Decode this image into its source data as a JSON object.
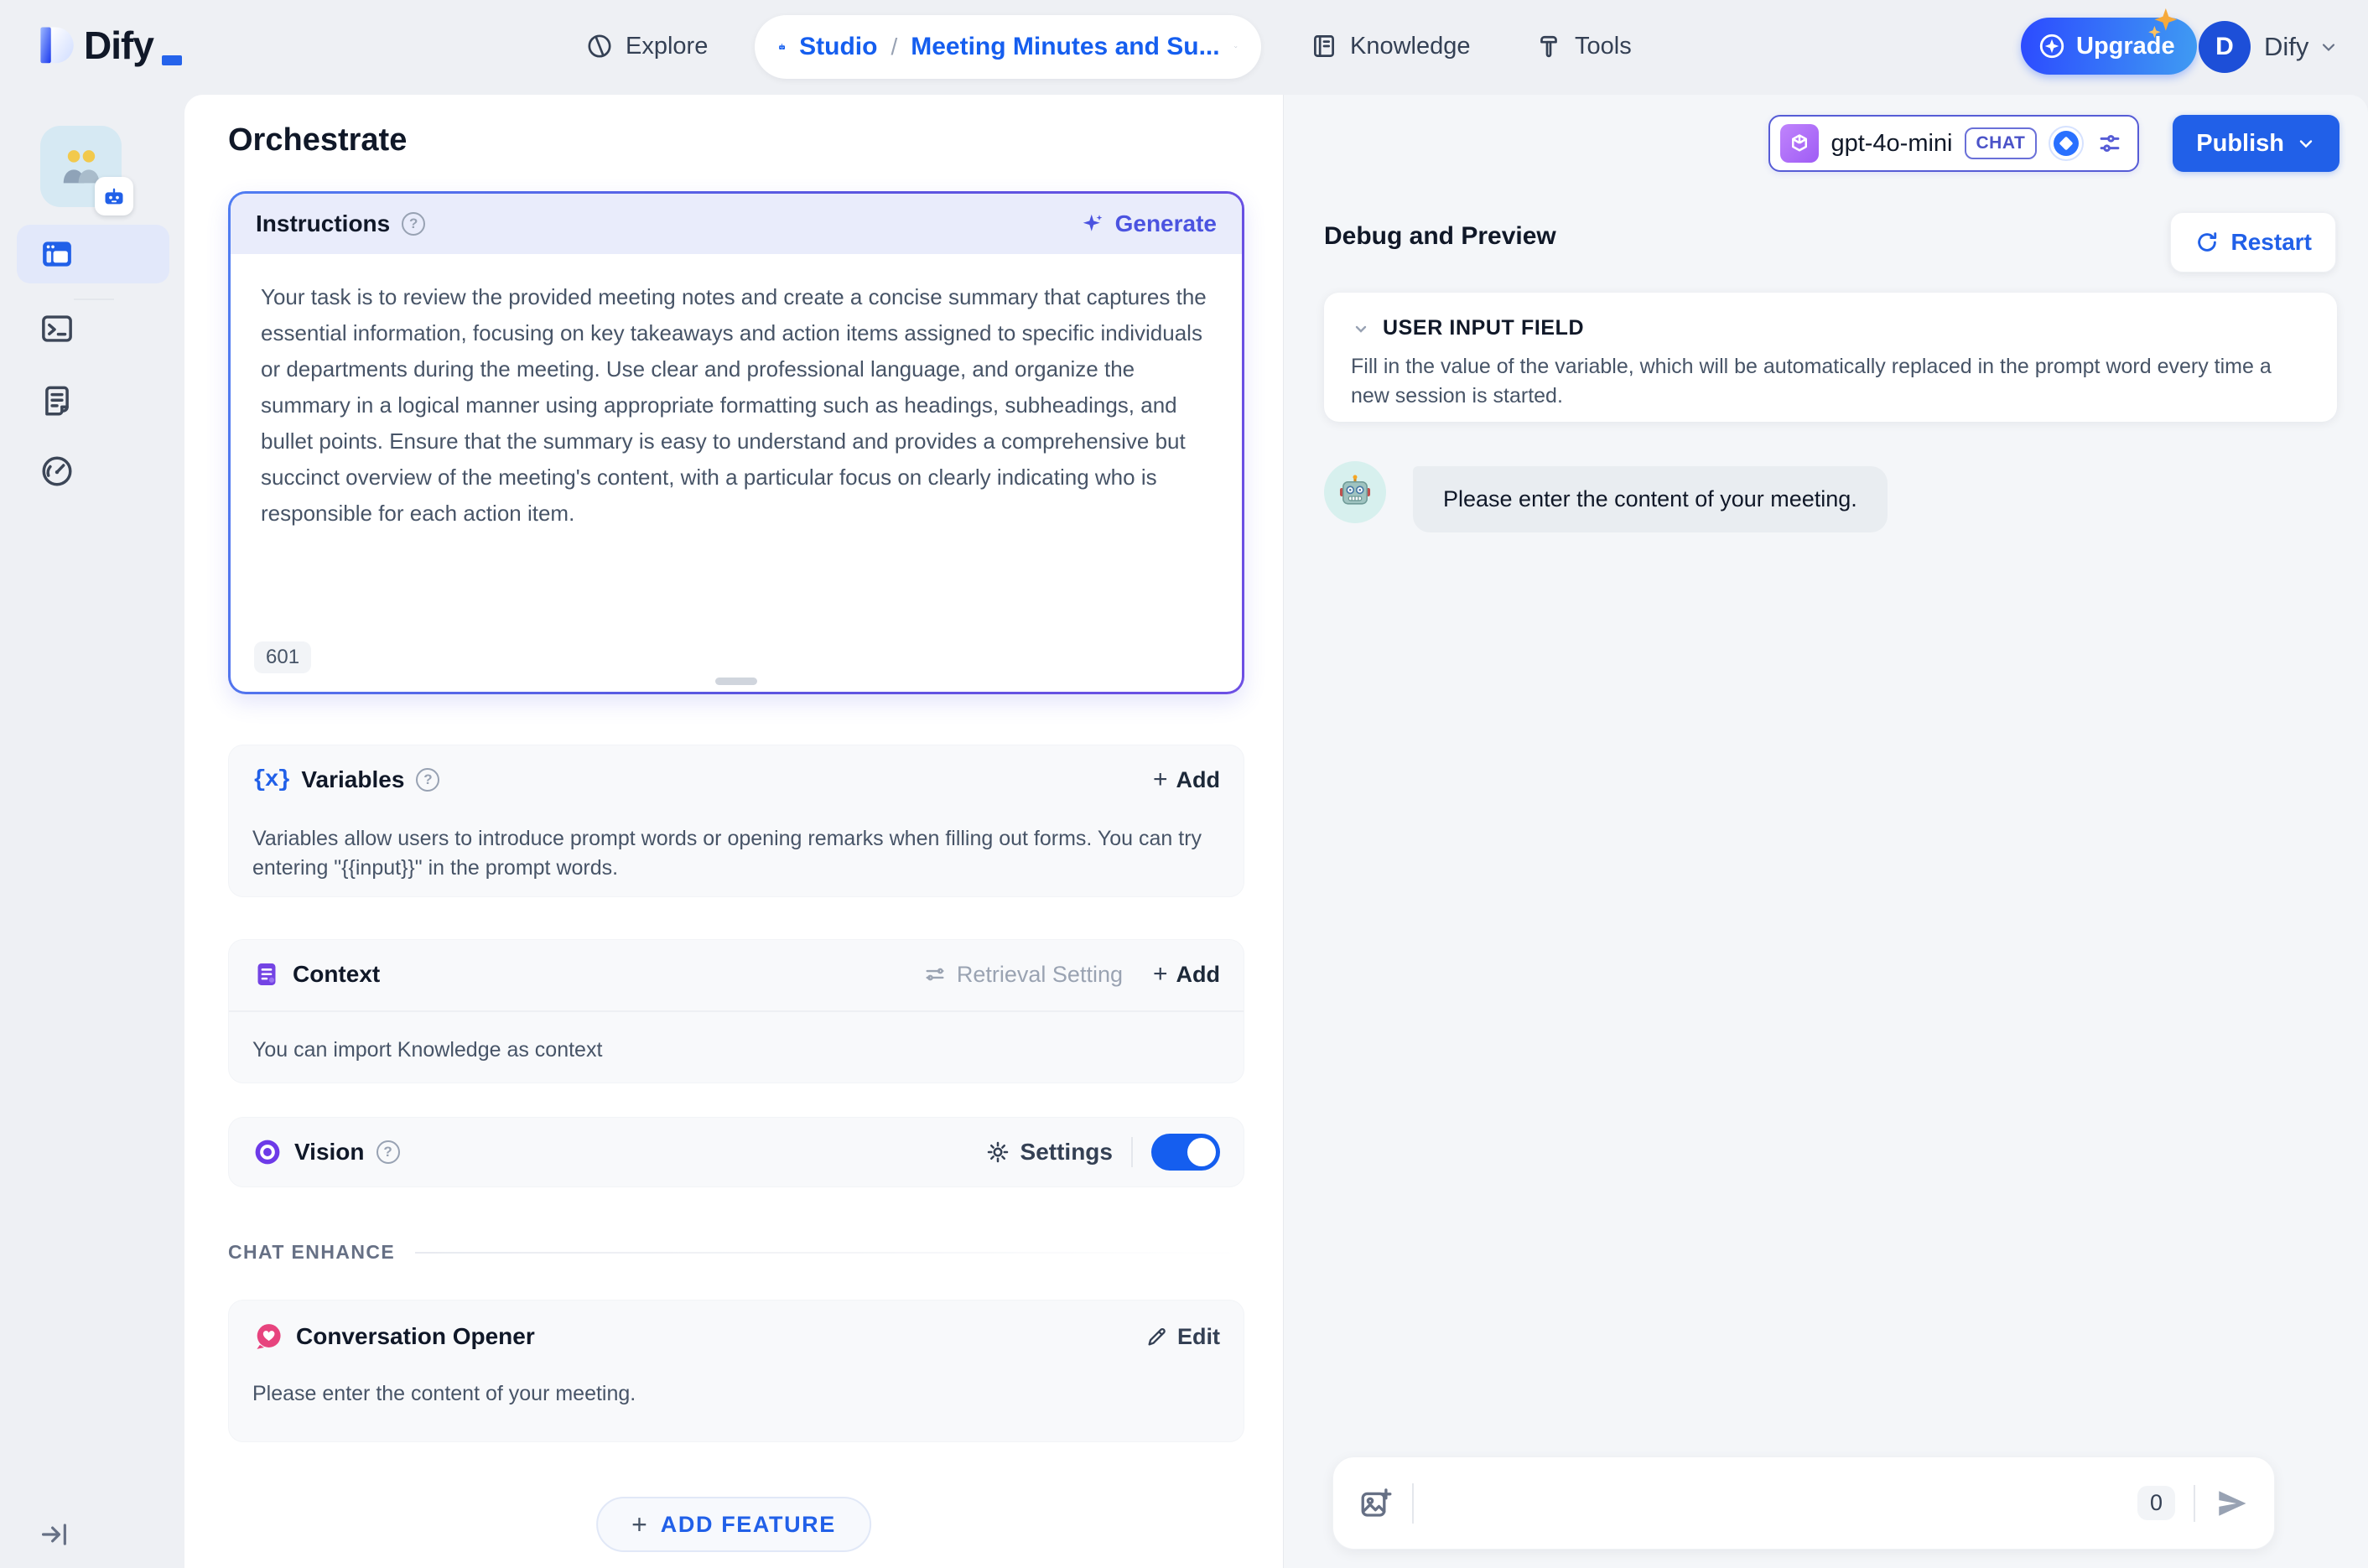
{
  "header": {
    "logo_text": "Dify",
    "explore": "Explore",
    "studio": "Studio",
    "breadcrumb_separator": "/",
    "app_name": "Meeting Minutes and Su...",
    "knowledge": "Knowledge",
    "tools": "Tools",
    "upgrade_label": "Upgrade",
    "avatar_letter": "D",
    "account_name": "Dify"
  },
  "page": {
    "title": "Orchestrate"
  },
  "model_bar": {
    "model_name": "gpt-4o-mini",
    "model_mode_badge": "CHAT",
    "publish_label": "Publish"
  },
  "help_glyph": "?",
  "config": {
    "instructions": {
      "title": "Instructions",
      "generate_label": "Generate",
      "text": "Your task is to review the provided meeting notes and create a concise summary that captures the essential information, focusing on key takeaways and action items assigned to specific individuals or departments during the meeting. Use clear and professional language, and organize the summary in a logical manner using appropriate formatting such as headings, subheadings, and bullet points. Ensure that the summary is easy to understand and provides a comprehensive but succinct overview of the meeting's content, with a particular focus on clearly indicating who is responsible for each action item.",
      "char_count": "601"
    },
    "variables": {
      "icon_glyph": "{x}",
      "title": "Variables",
      "plus_glyph": "+",
      "add_label": "Add",
      "description": "Variables allow users to introduce prompt words or opening remarks when filling out forms. You can try entering \"{{input}}\" in the prompt words."
    },
    "context": {
      "title": "Context",
      "retrieval_setting_label": "Retrieval Setting",
      "plus_glyph": "+",
      "add_label": "Add",
      "description": "You can import Knowledge as context"
    },
    "vision": {
      "title": "Vision",
      "settings_label": "Settings",
      "enabled": true
    },
    "chat_enhance_label": "CHAT ENHANCE",
    "conversation_opener": {
      "title": "Conversation Opener",
      "edit_label": "Edit",
      "text": "Please enter the content of your meeting."
    },
    "add_feature": {
      "plus_glyph": "+",
      "label": "ADD FEATURE"
    }
  },
  "debug": {
    "title": "Debug and Preview",
    "restart_label": "Restart",
    "user_input_field": {
      "title": "USER INPUT FIELD",
      "description": "Fill in the value of the variable, which will be automatically replaced in the prompt word every time a new session is started."
    },
    "bot_message": "Please enter the content of your meeting.",
    "composer": {
      "char_count": "0"
    }
  },
  "colors": {
    "accent_blue": "#155eef",
    "accent_indigo": "#4b53e0",
    "purple": "#6d3ae8",
    "pink": "#e7447e",
    "toggle_on": "#155eef",
    "publish_blue": "#2160e8"
  }
}
